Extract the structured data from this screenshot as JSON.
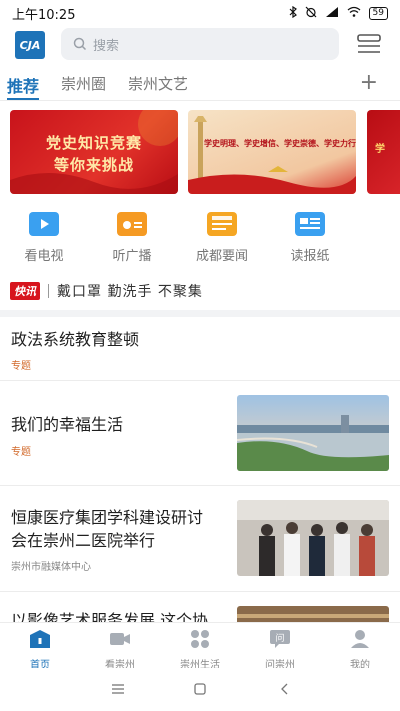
{
  "status_bar": {
    "time": "上午10:25",
    "battery": "59"
  },
  "header": {
    "logo_text": "CJA",
    "search_placeholder": "搜索"
  },
  "tabs": {
    "items": [
      {
        "label": "推荐",
        "active": true
      },
      {
        "label": "崇州圈",
        "active": false
      },
      {
        "label": "崇州文艺",
        "active": false
      }
    ]
  },
  "banners": [
    {
      "line1": "党史知识竞赛",
      "line2": "等你来挑战"
    },
    {
      "text": "学史明理、学史增信、学史崇德、学史力行"
    },
    {
      "text": "学"
    }
  ],
  "quick_access": [
    {
      "label": "看电视",
      "icon": "tv-icon",
      "color": "#3aa0f0"
    },
    {
      "label": "听广播",
      "icon": "radio-icon",
      "color": "#f59a23"
    },
    {
      "label": "成都要闻",
      "icon": "news-icon",
      "color": "#f5a623"
    },
    {
      "label": "读报纸",
      "icon": "newspaper-icon",
      "color": "#3aa0f0"
    }
  ],
  "flash": {
    "badge": "快讯",
    "text": "戴口罩 勤洗手 不聚集"
  },
  "news": [
    {
      "title": "政法系统教育整顿",
      "tag": "专题"
    },
    {
      "title": "我们的幸福生活",
      "tag": "专题"
    },
    {
      "title_line1": "恒康医疗集团学科建设研讨",
      "title_line2": "会在崇州二医院举行",
      "source": "崇州市融媒体中心"
    },
    {
      "title": "以影像艺术服务发展 这个协"
    }
  ],
  "bottom_nav": [
    {
      "label": "首页",
      "active": true
    },
    {
      "label": "看崇州",
      "active": false
    },
    {
      "label": "崇州生活",
      "active": false
    },
    {
      "label": "问崇州",
      "active": false
    },
    {
      "label": "我的",
      "active": false
    }
  ],
  "colors": {
    "accent": "#1e73b8",
    "flash_red": "#d7141d",
    "tag_orange": "#d2692a"
  }
}
